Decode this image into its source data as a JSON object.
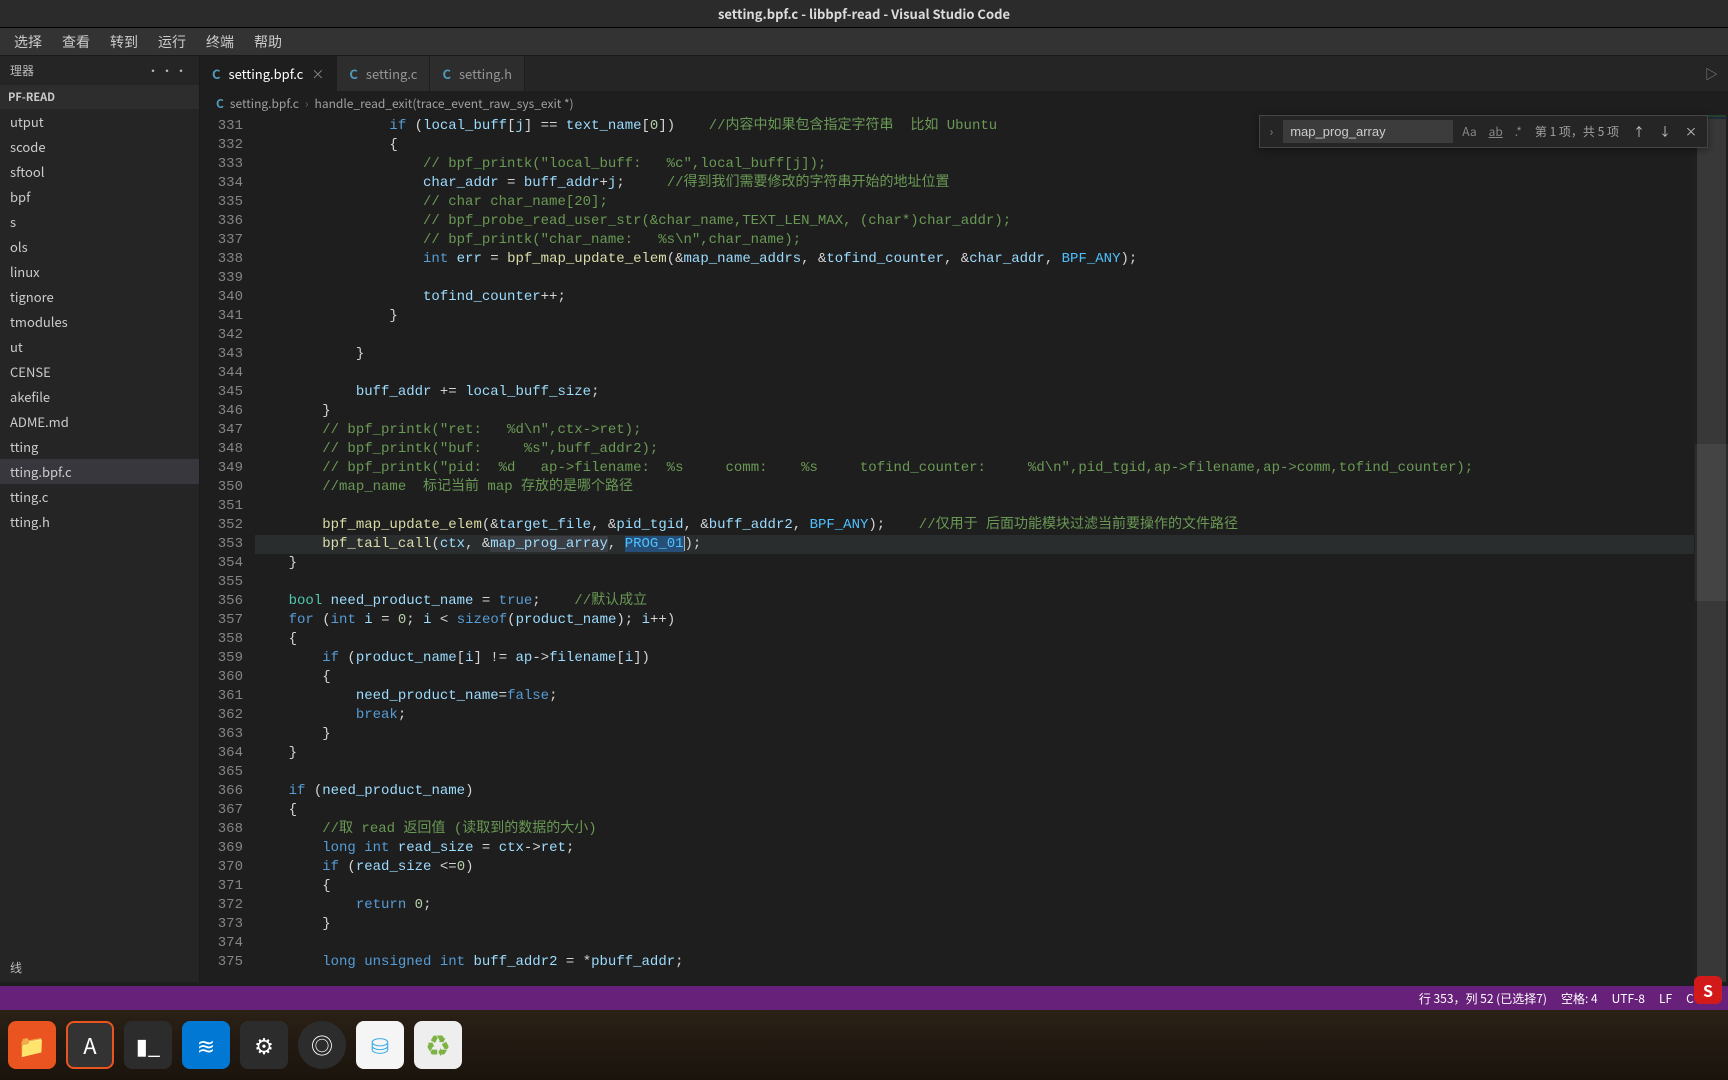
{
  "os_title": "setting.bpf.c - libbpf-read - Visual Studio Code",
  "menu": [
    "选择",
    "查看",
    "转到",
    "运行",
    "终端",
    "帮助"
  ],
  "sidebar": {
    "header_label": "理器",
    "header_actions": "···",
    "section": "PF-READ",
    "items": [
      "utput",
      "scode",
      "sftool",
      "bpf",
      "s",
      "ols",
      "linux",
      "tignore",
      "tmodules",
      "ut",
      "CENSE",
      "akefile",
      "ADME.md",
      "tting",
      "tting.bpf.c",
      "tting.c",
      "tting.h"
    ],
    "selected_index": 14,
    "footer": "线"
  },
  "tabs": [
    {
      "lang": "C",
      "label": "setting.bpf.c",
      "active": true,
      "close": true
    },
    {
      "lang": "C",
      "label": "setting.c",
      "active": false,
      "close": false
    },
    {
      "lang": "C",
      "label": "setting.h",
      "active": false,
      "close": false
    }
  ],
  "breadcrumb": {
    "lang": "C",
    "file": "setting.bpf.c",
    "symbol": "handle_read_exit(trace_event_raw_sys_exit *)"
  },
  "find": {
    "value": "map_prog_array",
    "results": "第 1 项，共 5 项",
    "case_icon": "Aa",
    "word_icon": "ab",
    "regex_icon": ".*"
  },
  "gutter_lines": [
    "331",
    "332",
    "333",
    "334",
    "335",
    "336",
    "337",
    "338",
    "339",
    "340",
    "341",
    "342",
    "343",
    "344",
    "345",
    "346",
    "347",
    "348",
    "349",
    "350",
    "351",
    "352",
    "353",
    "354",
    "355",
    "356",
    "357",
    "358",
    "359",
    "360",
    "361",
    "362",
    "363",
    "364",
    "365",
    "366",
    "367",
    "368",
    "369",
    "370",
    "371",
    "372",
    "373",
    "374",
    "375"
  ],
  "code": {
    "331": {
      "indent": "                ",
      "pre": "if (",
      "var1": "local_buff",
      "mid": "[",
      "var2": "j",
      "mid2": "] == ",
      "var3": "text_name",
      "mid3": "[",
      "num": "0",
      "tail": "])",
      "com": "    //内容中如果包含指定字符串  比如 Ubuntu"
    },
    "332": "                {",
    "333": {
      "indent": "                    ",
      "com": "// bpf_printk(\"local_buff:   %c\",local_buff[j]);"
    },
    "334": {
      "indent": "                    ",
      "var": "char_addr",
      " = ": " = ",
      "rhs": "buff_addr+j;",
      "com": "     //得到我们需要修改的字符串开始的地址位置"
    },
    "335": {
      "indent": "                    ",
      "com": "// char char_name[20];"
    },
    "336": {
      "indent": "                    ",
      "com": "// bpf_probe_read_user_str(&char_name,TEXT_LEN_MAX, (char*)char_addr);"
    },
    "337": {
      "indent": "                    ",
      "com": "// bpf_printk(\"char_name:   %s\\n\",char_name);"
    },
    "338": {
      "indent": "                    ",
      "kw": "int ",
      "var": "err",
      " = ": " = ",
      "fn": "bpf_map_update_elem",
      "args": "(&map_name_addrs, &tofind_counter, &char_addr, ",
      "const": "BPF_ANY",
      "tail": ");"
    },
    "339": "",
    "340": {
      "indent": "                    ",
      "stmt": "tofind_counter++;"
    },
    "341": "                }",
    "342": "",
    "343": "            }",
    "344": "",
    "345": {
      "indent": "            ",
      "var": "buff_addr",
      " += ": " += ",
      "rhs": "local_buff_size;"
    },
    "346": "        }",
    "347": {
      "indent": "        ",
      "com": "// bpf_printk(\"ret:   %d\\n\",ctx->ret);"
    },
    "348": {
      "indent": "        ",
      "com": "// bpf_printk(\"buf:     %s\",buff_addr2);"
    },
    "349": {
      "indent": "        ",
      "com": "// bpf_printk(\"pid:  %d   ap->filename:  %s     comm:    %s     tofind_counter:     %d\\n\",pid_tgid,ap->filename,ap->comm,tofind_counter);"
    },
    "350": {
      "indent": "        ",
      "com": "//map_name  标记当前 map 存放的是哪个路径"
    },
    "351": "",
    "352": {
      "indent": "        ",
      "fn": "bpf_map_update_elem",
      "args": "(&target_file, &pid_tgid, &buff_addr2, ",
      "const": "BPF_ANY",
      "tail": ");",
      "com": "    //仅用于 后面功能模块过滤当前要操作的文件路径"
    },
    "353": {
      "indent": "        ",
      "fn": "bpf_tail_call",
      "args_a": "(ctx, &",
      "hl": "map_prog_array",
      "args_b": ", ",
      "sel": "PROG_01",
      "tail": ");"
    },
    "354": "    }",
    "355": "",
    "356": {
      "indent": "    ",
      "kw": "bool ",
      "var": "need_product_name",
      " = ": " = ",
      "val": "true",
      "tail": ";",
      "com": "    //默认成立"
    },
    "357": {
      "indent": "    ",
      "kw": "for ",
      "open": "(",
      "type": "int ",
      "var": "i",
      " = ": " = ",
      "n0": "0",
      "sep": "; ",
      "var2": "i",
      " < ": " < ",
      "fn": "sizeof",
      "args": "(product_name)",
      "sep2": "; ",
      "inc": "i++",
      "close": ")"
    },
    "358": "    {",
    "359": {
      "indent": "        ",
      "kw": "if ",
      "cond": "(product_name[i] != ap->filename[i])"
    },
    "360": "        {",
    "361": {
      "indent": "            ",
      "var": "need_product_name",
      "eq": "=",
      "val": "false",
      "tail": ";"
    },
    "362": {
      "indent": "            ",
      "kw": "break",
      "tail": ";"
    },
    "363": "        }",
    "364": "    }",
    "365": "",
    "366": {
      "indent": "    ",
      "kw": "if ",
      "cond": "(need_product_name)"
    },
    "367": "    {",
    "368": {
      "indent": "        ",
      "com": "//取 read 返回值 (读取到的数据的大小)"
    },
    "369": {
      "indent": "        ",
      "type": "long int ",
      "var": "read_size",
      " = ": " = ",
      "rhs": "ctx->ret;"
    },
    "370": {
      "indent": "        ",
      "kw": "if ",
      "cond": "(read_size <=0)"
    },
    "371": "        {",
    "372": {
      "indent": "            ",
      "kw": "return ",
      "n": "0",
      "tail": ";"
    },
    "373": "        }",
    "374": "",
    "375": {
      "indent": "        ",
      "type": "long unsigned int ",
      "var": "buff_addr2",
      " = ": " = *",
      "rhs": "pbuff_addr;"
    }
  },
  "status": {
    "pos": "行 353，列 52 (已选择7)",
    "spaces": "空格: 4",
    "enc": "UTF-8",
    "eol": "LF",
    "lang": "C",
    "feedback_icon": "☺"
  },
  "ime": "S",
  "dock_apps": [
    "files",
    "store",
    "term",
    "vsc",
    "gear",
    "obs",
    "ark",
    "trash"
  ],
  "chart_data": {
    "type": "table",
    "note": "not-a-chart"
  }
}
